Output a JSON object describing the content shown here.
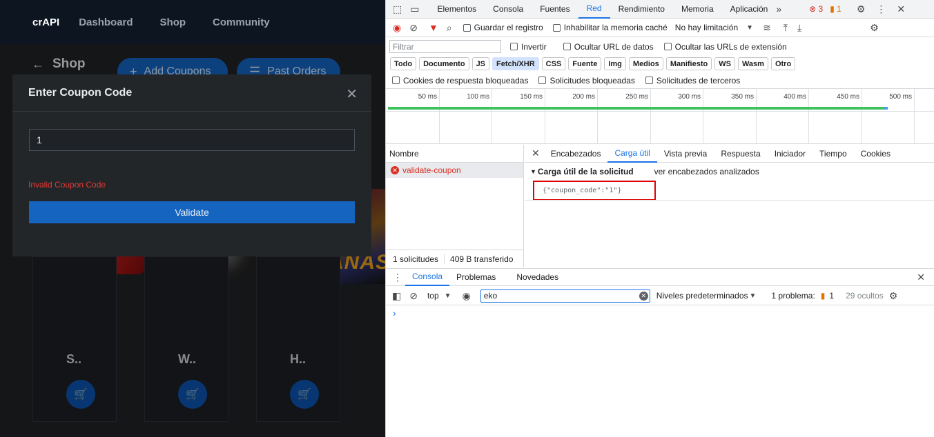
{
  "app": {
    "brand": "crAPI",
    "nav": [
      "Dashboard",
      "Shop",
      "Community"
    ],
    "shop_title": "Shop",
    "add_coupons": "Add Coupons",
    "past_orders": "Past Orders",
    "products": [
      {
        "title": "S..",
        "cart_icon": "cart-icon"
      },
      {
        "title": "W..",
        "cart_icon": "cart-icon"
      },
      {
        "title": "H..",
        "cart_icon": "cart-icon"
      }
    ],
    "poster_text": "INSANAS",
    "modal": {
      "title": "Enter Coupon Code",
      "input_value": "1",
      "error": "Invalid Coupon Code",
      "validate": "Validate"
    }
  },
  "devtools": {
    "tabs": [
      "Elementos",
      "Consola",
      "Fuentes",
      "Red",
      "Rendimiento",
      "Memoria",
      "Aplicación"
    ],
    "active_tab": "Red",
    "error_count": "3",
    "warning_count": "1",
    "toolbar": {
      "preserve_log": "Guardar el registro",
      "disable_cache": "Inhabilitar la memoria caché",
      "throttling": "No hay limitación"
    },
    "filter": {
      "placeholder": "Filtrar",
      "invert": "Invertir",
      "hide_data_urls": "Ocultar URL de datos",
      "hide_ext_urls": "Ocultar las URLs de extensión"
    },
    "types": [
      "Todo",
      "Documento",
      "JS",
      "Fetch/XHR",
      "CSS",
      "Fuente",
      "Img",
      "Medios",
      "Manifiesto",
      "WS",
      "Wasm",
      "Otro"
    ],
    "active_type": "Fetch/XHR",
    "checks": [
      "Cookies de respuesta bloqueadas",
      "Solicitudes bloqueadas",
      "Solicitudes de terceros"
    ],
    "timeline_ticks": [
      "50 ms",
      "100 ms",
      "150 ms",
      "200 ms",
      "250 ms",
      "300 ms",
      "350 ms",
      "400 ms",
      "450 ms",
      "500 ms"
    ],
    "requests": {
      "header": "Nombre",
      "items": [
        {
          "name": "validate-coupon",
          "status": "error"
        }
      ],
      "summary_count": "1 solicitudes",
      "summary_transfer": "409 B transferido"
    },
    "detail": {
      "tabs": [
        "Encabezados",
        "Carga útil",
        "Vista previa",
        "Respuesta",
        "Iniciador",
        "Tiempo",
        "Cookies"
      ],
      "active_tab": "Carga útil",
      "section_title": "Carga útil de la solicitud",
      "parsed_link": "ver encabezados analizados",
      "payload": "{\"coupon_code\":\"1\"}"
    },
    "console": {
      "tabs": [
        "Consola",
        "Problemas",
        "Novedades"
      ],
      "active_tab": "Consola",
      "context": "top",
      "filter_value": "eko",
      "levels": "Niveles predeterminados",
      "issues_label": "1 problema:",
      "issues_count": "1",
      "hidden": "29 ocultos"
    }
  },
  "colors": {
    "accent_blue": "#1a73e8",
    "error_red": "#d93025",
    "app_primary": "#1565c0",
    "highlight_box": "#e00000"
  }
}
